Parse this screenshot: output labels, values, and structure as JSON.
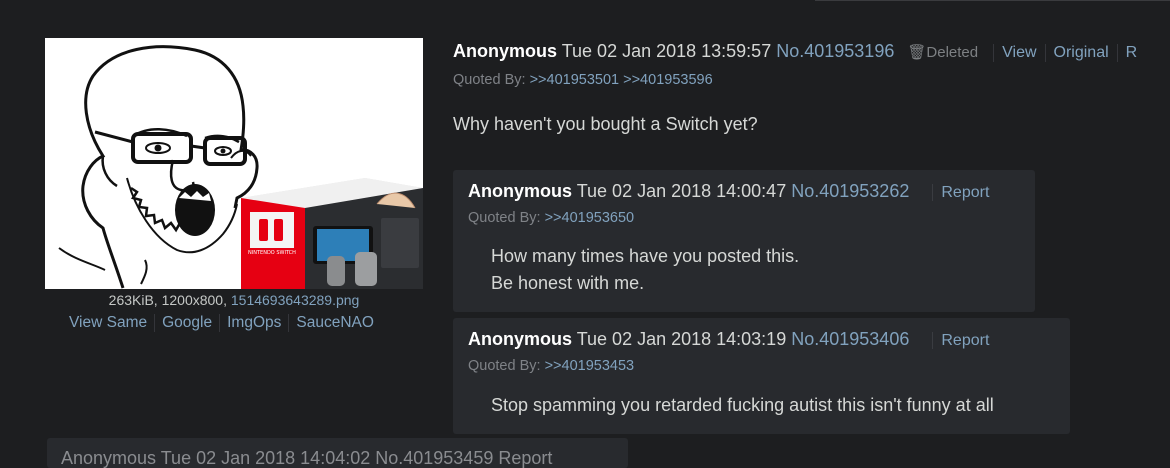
{
  "file": {
    "info": "263KiB, 1200x800,",
    "filename": "1514693643289.png",
    "links": [
      "View Same",
      "Google",
      "ImgOps",
      "SauceNAO"
    ],
    "box_brand": "NINTENDO SWITCH"
  },
  "op": {
    "name": "Anonymous",
    "date": "Tue 02 Jan 2018 13:59:57",
    "number": "No.401953196",
    "deleted": "Deleted",
    "actions": [
      "View",
      "Original",
      "R"
    ],
    "quoted_by_label": "Quoted By:",
    "quoted_by": [
      ">>401953501",
      ">>401953596"
    ],
    "message": "Why haven't you bought a Switch yet?"
  },
  "replies": [
    {
      "name": "Anonymous",
      "date": "Tue 02 Jan 2018 14:00:47",
      "number": "No.401953262",
      "report": "Report",
      "quoted_by_label": "Quoted By:",
      "quoted_by": ">>401953650",
      "lines": [
        "How many times have you posted this.",
        "Be honest with me."
      ]
    },
    {
      "name": "Anonymous",
      "date": "Tue 02 Jan 2018 14:03:19",
      "number": "No.401953406",
      "report": "Report",
      "quoted_by_label": "Quoted By:",
      "quoted_by": ">>401953453",
      "lines": [
        "Stop spamming you retarded fucking autist this isn't funny at all"
      ]
    }
  ],
  "partial": {
    "text": "Anonymous Tue 02 Jan 2018 14:04:02 No.401953459 Report"
  },
  "colors": {
    "background": "#1d1e20",
    "post_background": "#282a2e",
    "link": "#81a2be",
    "name": "#ffffff"
  }
}
